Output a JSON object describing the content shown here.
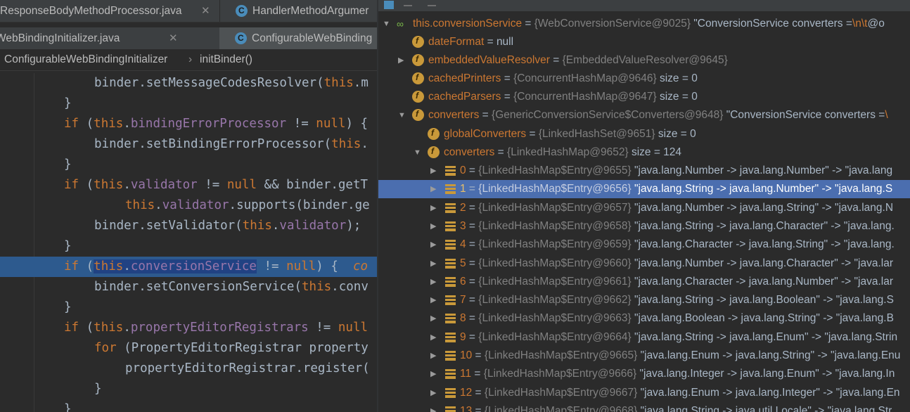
{
  "editor": {
    "tabs_row1": [
      {
        "label": "ResponseBodyMethodProcessor.java",
        "close": "✕"
      },
      {
        "label": "HandlerMethodArgumer",
        "close": ""
      }
    ],
    "tabs_row2": [
      {
        "label": "WebBindingInitializer.java",
        "close": "✕"
      },
      {
        "label": "ConfigurableWebBinding",
        "close": ""
      }
    ],
    "breadcrumb": {
      "class_name": "ConfigurableWebBindingInitializer",
      "separator": "›",
      "method": "initBinder()"
    },
    "code": {
      "l0": {
        "a": "binder.setMessageCodesResolver(",
        "b": "this",
        "c": ".m"
      },
      "l1": {
        "a": "}"
      },
      "l2": {
        "a": "if",
        "b": " (",
        "c": "this",
        "d": ".",
        "e": "bindingErrorProcessor",
        "f": " != ",
        "g": "null",
        "h": ") {"
      },
      "l3": {
        "a": "binder.setBindingErrorProcessor(",
        "b": "this",
        "c": "."
      },
      "l4": {
        "a": "}"
      },
      "l5": {
        "a": "if",
        "b": " (",
        "c": "this",
        "d": ".",
        "e": "validator",
        "f": " != ",
        "g": "null",
        "h": " && binder.getT"
      },
      "l6": {
        "a": "this",
        "b": ".",
        "c": "validator",
        "d": ".supports(binder.ge"
      },
      "l7": {
        "a": "binder.setValidator(",
        "b": "this",
        "c": ".",
        "d": "validator",
        "e": ");"
      },
      "l8": {
        "a": "}"
      },
      "l9": {
        "a": "if",
        "b": " (",
        "c": "this",
        "d": ".",
        "e": "conversionService",
        "f": " != ",
        "g": "null",
        "h": ") {  ",
        "i": "co"
      },
      "l10": {
        "a": "binder.setConversionService(",
        "b": "this",
        "c": ".conv"
      },
      "l11": {
        "a": "}"
      },
      "l12": {
        "a": "if",
        "b": " (",
        "c": "this",
        "d": ".",
        "e": "propertyEditorRegistrars",
        "f": " != ",
        "g": "null"
      },
      "l13": {
        "a": "for",
        "b": " (PropertyEditorRegistrar property"
      },
      "l14": {
        "a": "propertyEditorRegistrar.register("
      },
      "l15": {
        "a": "}"
      },
      "l16": {
        "a": "}"
      }
    }
  },
  "debugger": {
    "root": {
      "name": "this.conversionService",
      "eq": " = ",
      "type": "{WebConversionService@9025}",
      "value": " \"ConversionService converters =",
      "esc": "\\n\\t",
      "tail": "@o"
    },
    "children": [
      {
        "name": "dateFormat",
        "eq": " = ",
        "type": "",
        "value": "null",
        "arrow": ""
      },
      {
        "name": "embeddedValueResolver",
        "eq": " = ",
        "type": "{EmbeddedValueResolver@9645}",
        "value": "",
        "arrow": "▶"
      },
      {
        "name": "cachedPrinters",
        "eq": " = ",
        "type": "{ConcurrentHashMap@9646}",
        "value": "  size = 0",
        "arrow": ""
      },
      {
        "name": "cachedParsers",
        "eq": " = ",
        "type": "{ConcurrentHashMap@9647}",
        "value": "  size = 0",
        "arrow": ""
      },
      {
        "name": "converters",
        "eq": " = ",
        "type": "{GenericConversionService$Converters@9648}",
        "value": " \"ConversionService converters =",
        "esc": "\\",
        "arrow": "▼"
      }
    ],
    "converters_children": [
      {
        "name": "globalConverters",
        "eq": " = ",
        "type": "{LinkedHashSet@9651}",
        "value": "  size = 0",
        "arrow": ""
      },
      {
        "name": "converters",
        "eq": " = ",
        "type": "{LinkedHashMap@9652}",
        "value": "  size = 124",
        "arrow": "▼"
      }
    ],
    "entries": [
      {
        "index": "0",
        "type": "{LinkedHashMap$Entry@9655}",
        "value": " \"java.lang.Number -> java.lang.Number\" -> \"java.lang"
      },
      {
        "index": "1",
        "type": "{LinkedHashMap$Entry@9656}",
        "value": " \"java.lang.String -> java.lang.Number\" -> \"java.lang.S"
      },
      {
        "index": "2",
        "type": "{LinkedHashMap$Entry@9657}",
        "value": " \"java.lang.Number -> java.lang.String\" -> \"java.lang.N"
      },
      {
        "index": "3",
        "type": "{LinkedHashMap$Entry@9658}",
        "value": " \"java.lang.String -> java.lang.Character\" -> \"java.lang."
      },
      {
        "index": "4",
        "type": "{LinkedHashMap$Entry@9659}",
        "value": " \"java.lang.Character -> java.lang.String\" -> \"java.lang."
      },
      {
        "index": "5",
        "type": "{LinkedHashMap$Entry@9660}",
        "value": " \"java.lang.Number -> java.lang.Character\" -> \"java.lar"
      },
      {
        "index": "6",
        "type": "{LinkedHashMap$Entry@9661}",
        "value": " \"java.lang.Character -> java.lang.Number\" -> \"java.lar"
      },
      {
        "index": "7",
        "type": "{LinkedHashMap$Entry@9662}",
        "value": " \"java.lang.String -> java.lang.Boolean\" -> \"java.lang.S"
      },
      {
        "index": "8",
        "type": "{LinkedHashMap$Entry@9663}",
        "value": " \"java.lang.Boolean -> java.lang.String\" -> \"java.lang.B"
      },
      {
        "index": "9",
        "type": "{LinkedHashMap$Entry@9664}",
        "value": " \"java.lang.String -> java.lang.Enum\" -> \"java.lang.Strin"
      },
      {
        "index": "10",
        "type": "{LinkedHashMap$Entry@9665}",
        "value": " \"java.lang.Enum -> java.lang.String\" -> \"java.lang.Enu"
      },
      {
        "index": "11",
        "type": "{LinkedHashMap$Entry@9666}",
        "value": " \"java.lang.Integer -> java.lang.Enum\" -> \"java.lang.In"
      },
      {
        "index": "12",
        "type": "{LinkedHashMap$Entry@9667}",
        "value": " \"java.lang.Enum -> java.lang.Integer\" -> \"java.lang.En"
      },
      {
        "index": "13",
        "type": "{LinkedHashMap$Entry@9668}",
        "value": " \"java.lang.String -> java.util.Locale\" -> \"java.lang.Str"
      }
    ],
    "selected_index": 1
  },
  "colors": {
    "selection_line": "#2d5a8e",
    "selected_row": "#4b6eaf",
    "keyword": "#cc7832",
    "field": "#9876aa"
  }
}
